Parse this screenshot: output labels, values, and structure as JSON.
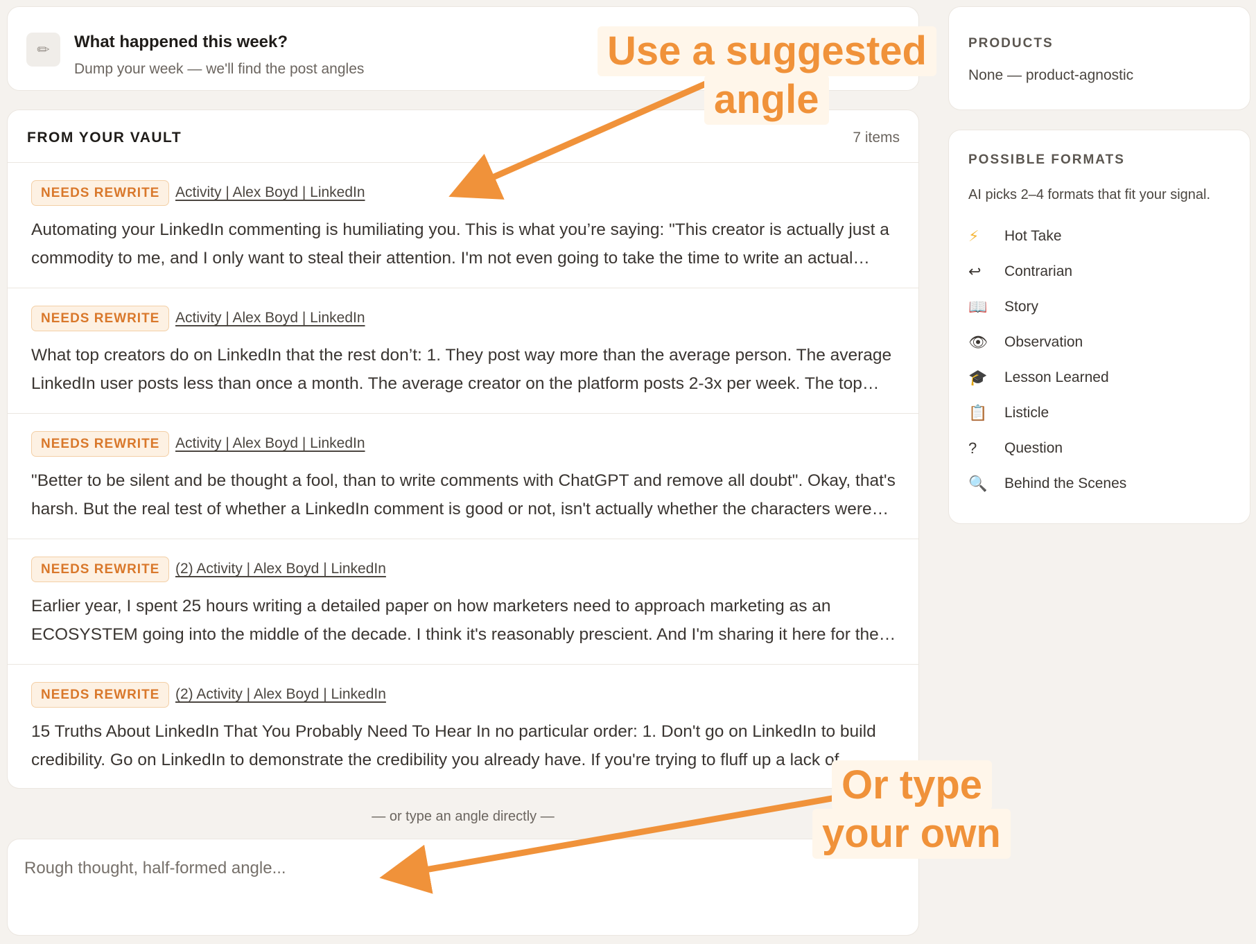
{
  "week": {
    "icon": "pencil-icon",
    "title": "What happened this week?",
    "subtitle": "Dump your week — we'll find the post angles"
  },
  "vault": {
    "heading": "FROM YOUR VAULT",
    "count": "7 items",
    "items": [
      {
        "badge": "NEEDS REWRITE",
        "source": "Activity | Alex Boyd | LinkedIn",
        "excerpt": "Automating your LinkedIn commenting is humiliating you. This is what you’re saying: \"This creator is actually just a commodity to me, and I only want to steal their attention. I'm not even going to take the time to write an actual comment myself.\""
      },
      {
        "badge": "NEEDS REWRITE",
        "source": "Activity | Alex Boyd | LinkedIn",
        "excerpt": "What top creators do on LinkedIn that the rest don’t: 1. They post way more than the average person. The average LinkedIn user posts less than once a month. The average creator on the platform posts 2-3x per week. The top creators post daily."
      },
      {
        "badge": "NEEDS REWRITE",
        "source": "Activity | Alex Boyd | LinkedIn",
        "excerpt": "\"Better to be silent and be thought a fool, than to write comments with ChatGPT and remove all doubt\". Okay, that's harsh. But the real test of whether a LinkedIn comment is good or not, isn't actually whether the characters were typed by a human."
      },
      {
        "badge": "NEEDS REWRITE",
        "source": "(2) Activity | Alex Boyd | LinkedIn",
        "excerpt": "Earlier year, I spent 25 hours writing a detailed paper on how marketers need to approach marketing as an ECOSYSTEM going into the middle of the decade. I think it's reasonably prescient. And I'm sharing it here for the first time."
      },
      {
        "badge": "NEEDS REWRITE",
        "source": "(2) Activity | Alex Boyd | LinkedIn",
        "excerpt": "15 Truths About LinkedIn That You Probably Need To Hear In no particular order: 1. Don't go on LinkedIn to build credibility. Go on LinkedIn to demonstrate the credibility you already have. If you're trying to fluff up a lack of"
      }
    ]
  },
  "or_divider": "— or type an angle directly —",
  "angle_input": {
    "placeholder": "Rough thought, half-formed angle...",
    "value": ""
  },
  "products": {
    "heading": "PRODUCTS",
    "value": "None — product-agnostic"
  },
  "formats": {
    "heading": "POSSIBLE FORMATS",
    "description": "AI picks 2–4 formats that fit your signal.",
    "items": [
      {
        "icon": "lightning-icon",
        "glyph": "⚡",
        "label": "Hot Take"
      },
      {
        "icon": "return-arrow-icon",
        "glyph": "↩",
        "label": "Contrarian"
      },
      {
        "icon": "book-icon",
        "glyph": "📖",
        "label": "Story"
      },
      {
        "icon": "eye-icon",
        "glyph": "👁",
        "label": "Observation"
      },
      {
        "icon": "graduation-cap-icon",
        "glyph": "🎓",
        "label": "Lesson Learned"
      },
      {
        "icon": "clipboard-icon",
        "glyph": "📋",
        "label": "Listicle"
      },
      {
        "icon": "question-icon",
        "glyph": "?",
        "label": "Question"
      },
      {
        "icon": "magnifier-icon",
        "glyph": "🔍",
        "label": "Behind the Scenes"
      }
    ]
  },
  "annotations": {
    "callout_1": {
      "line1": "Use a suggested",
      "line2": "angle"
    },
    "callout_2": {
      "line1": "Or type",
      "line2": "your own"
    },
    "color": "#f0923a"
  },
  "colors": {
    "accent": "#d9782b",
    "badge_bg": "#fdf1e3",
    "page_bg": "#f5f2ee"
  }
}
